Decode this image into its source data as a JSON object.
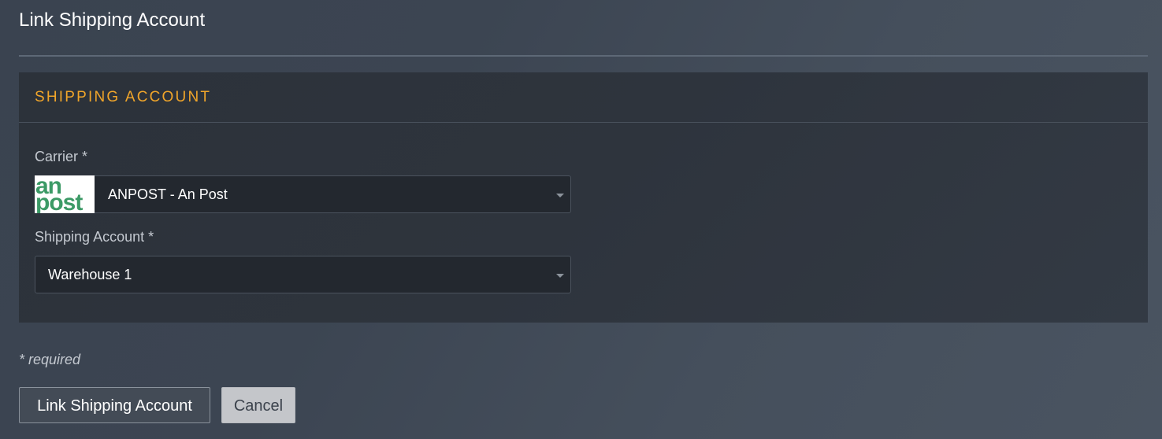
{
  "page": {
    "title": "Link Shipping Account"
  },
  "panel": {
    "title": "SHIPPING ACCOUNT"
  },
  "carrier": {
    "label": "Carrier *",
    "value": "ANPOST - An Post",
    "logo_line_1": "an",
    "logo_line_2": "post",
    "logo_color": "#3c9a66"
  },
  "shipping_account": {
    "label": "Shipping Account *",
    "value": "Warehouse 1"
  },
  "footer": {
    "required_note": "* required"
  },
  "actions": {
    "submit_label": "Link Shipping Account",
    "cancel_label": "Cancel"
  },
  "colors": {
    "accent": "#f0a52a"
  }
}
